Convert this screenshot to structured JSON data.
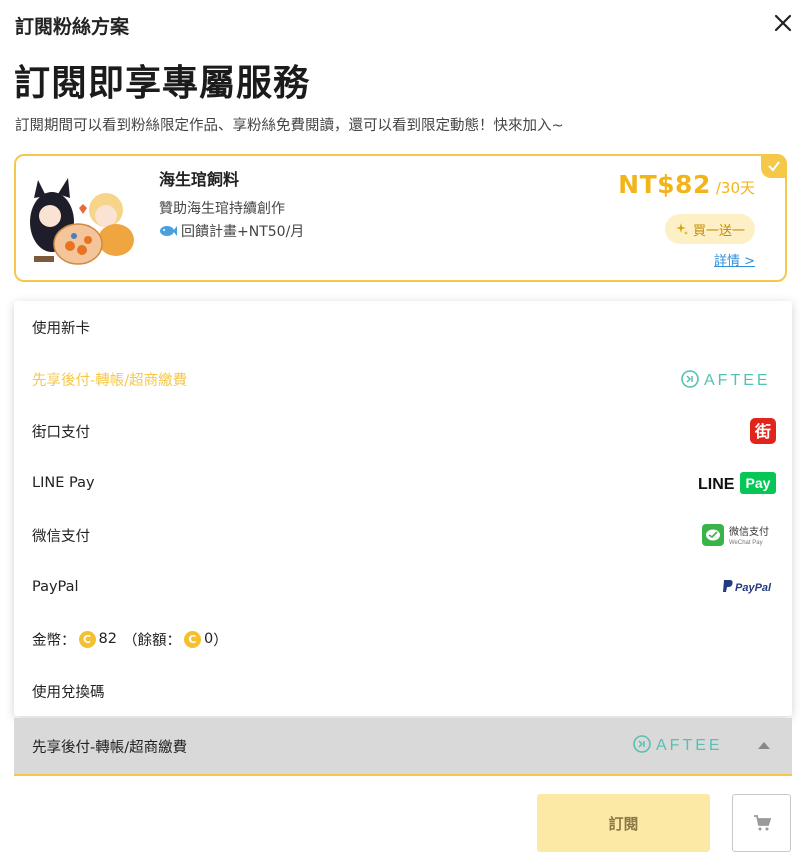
{
  "dialog": {
    "title": "訂閱粉絲方案",
    "close_icon": "close-icon"
  },
  "hero": {
    "title": "訂閱即享專屬服務",
    "description": "訂閱期間可以看到粉絲限定作品、享粉絲免費閱讀，還可以看到限定動態！快來加入~"
  },
  "plan": {
    "name": "海生琯飼料",
    "description": "贊助海生琯持續創作",
    "reward": "回饋計畫+NT50/月",
    "price": "NT$82",
    "period": "/30天",
    "promo": "買一送一",
    "details_link": "詳情 >",
    "accent_color": "#f5c84a"
  },
  "payment_menu": {
    "items": [
      {
        "label": "使用新卡",
        "logo": ""
      },
      {
        "label": "先享後付-轉帳/超商繳費",
        "logo": "aftee-logo",
        "logo_text": "AFTEE"
      },
      {
        "label": "街口支付",
        "logo": "jkopay-logo",
        "logo_text": "街"
      },
      {
        "label": "LINE Pay",
        "logo": "linepay-logo",
        "logo_text_1": "LINE",
        "logo_text_2": "Pay"
      },
      {
        "label": "微信支付",
        "logo": "wechatpay-logo",
        "logo_text_1": "微信支付",
        "logo_text_2": "WeChat Pay"
      },
      {
        "label": "PayPal",
        "logo": "paypal-logo",
        "logo_text": "PayPal"
      },
      {
        "label_prefix": "金幣：",
        "coin_amount": "82",
        "balance_prefix": "（餘額：",
        "balance_amount": "0",
        "balance_suffix": "）",
        "logo": ""
      },
      {
        "label": "使用兌換碼",
        "logo": ""
      }
    ]
  },
  "selected_payment": {
    "label": "先享後付-轉帳/超商繳費",
    "logo_text": "AFTEE"
  },
  "actions": {
    "subscribe_label": "訂閱",
    "cart_icon": "cart-icon"
  },
  "coin_glyph": "C"
}
